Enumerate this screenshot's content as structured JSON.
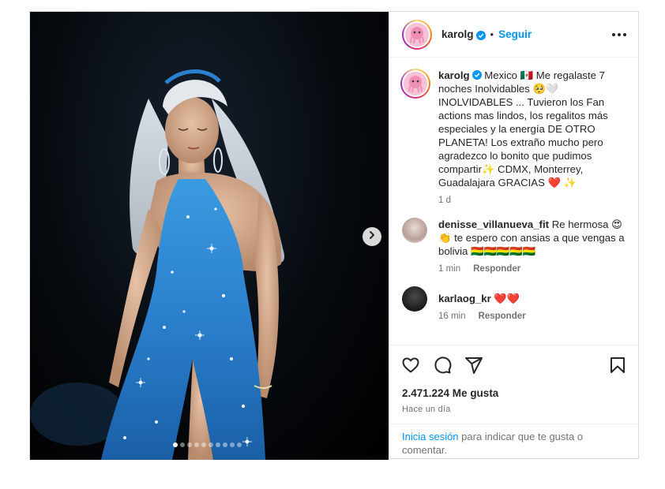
{
  "post": {
    "username": "karolg",
    "follow_label": "Seguir",
    "separator": "•",
    "caption": {
      "username": "karolg",
      "text": "Mexico 🇲🇽 Me regalaste 7 noches Inolvidables 🥺🤍 INOLVIDABLES ... Tuvieron los Fan actions mas lindos, los regalitos más especiales y la energía DE OTRO PLANETA! Los extraño mucho pero agradezco lo bonito que pudimos compartir✨ CDMX, Monterrey, Guadalajara GRACIAS ❤️ ✨",
      "time": "1 d"
    },
    "comments": [
      {
        "username": "denisse_villanueva_fit",
        "text": "Re hermosa 😍👏 te espero con ansias a que vengas a bolivia 🇧🇴🇧🇴🇧🇴🇧🇴🇧🇴",
        "time": "1 min",
        "reply_label": "Responder"
      },
      {
        "username": "karlaog_kr",
        "text": "❤️❤️",
        "time": "16 min",
        "reply_label": "Responder"
      }
    ],
    "likes": "2.471.224 Me gusta",
    "posted": "Hace un día",
    "login_prompt": {
      "link": "Inicia sesión",
      "text": " para indicar que te gusta o comentar."
    },
    "carousel": {
      "total": 10,
      "active": 1
    }
  },
  "icons": {
    "like": "heart-icon",
    "comment": "comment-icon",
    "share": "share-icon",
    "save": "bookmark-icon",
    "verified": "verified-badge-icon",
    "next": "chevron-right-icon",
    "more": "more-options-icon"
  },
  "colors": {
    "link": "#0095f6",
    "muted": "#737373",
    "text": "#262626",
    "border": "#dbdbdb"
  }
}
